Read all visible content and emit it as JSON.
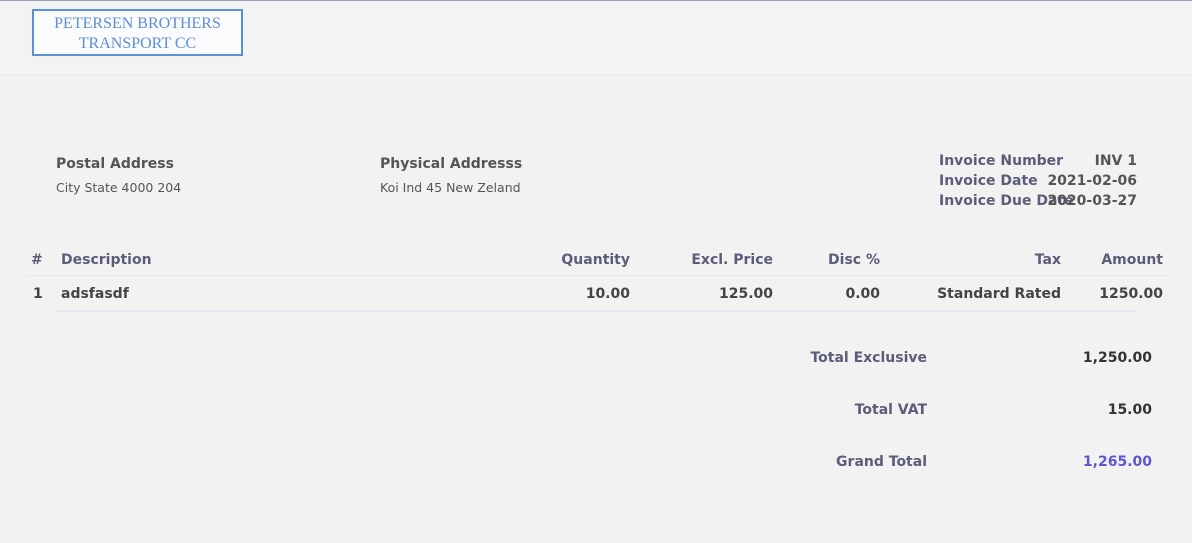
{
  "logo": {
    "line1": "PETERSEN BROTHERS",
    "line2": "TRANSPORT CC"
  },
  "addresses": {
    "postal_label": "Postal Address",
    "postal_value": "City State 4000 204",
    "physical_label": "Physical Addresss",
    "physical_value": "Koi Ind 45 New Zeland"
  },
  "invoice": {
    "number_label": "Invoice Number",
    "number_value": "INV 1",
    "date_label": "Invoice Date",
    "date_value": "2021-02-06",
    "due_label": "Invoice Due Date",
    "due_value": "2020-03-27"
  },
  "table": {
    "headers": [
      "#",
      "Description",
      "Quantity",
      "Excl. Price",
      "Disc %",
      "Tax",
      "Amount"
    ],
    "rows": [
      {
        "num": "1",
        "description": "adsfasdf",
        "quantity": "10.00",
        "excl_price": "125.00",
        "disc": "0.00",
        "tax": "Standard Rated",
        "amount": "1250.00"
      }
    ]
  },
  "totals": {
    "exclusive_label": "Total Exclusive",
    "exclusive_value": "1,250.00",
    "vat_label": "Total VAT",
    "vat_value": "15.00",
    "grand_label": "Grand Total",
    "grand_value": "1,265.00"
  },
  "colors": {
    "accent": "#5b55d0",
    "logo": "#5b8fd6",
    "header_text": "#5b5d78"
  }
}
